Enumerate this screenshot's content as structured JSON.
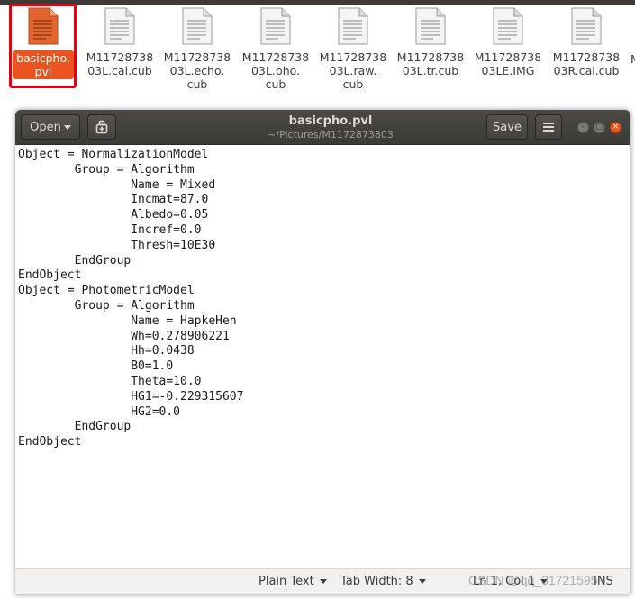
{
  "files": [
    {
      "name": "basicpho.\npvl",
      "type": "text",
      "selected": true
    },
    {
      "name": "M11728738\n03L.cal.cub",
      "type": "generic"
    },
    {
      "name": "M11728738\n03L.echo.\ncub",
      "type": "generic"
    },
    {
      "name": "M11728738\n03L.pho.\ncub",
      "type": "generic"
    },
    {
      "name": "M11728738\n03L.raw.\ncub",
      "type": "generic"
    },
    {
      "name": "M11728738\n03L.tr.cub",
      "type": "generic"
    },
    {
      "name": "M11728738\n03LE.IMG",
      "type": "generic"
    },
    {
      "name": "M11728738\n03R.cal.cub",
      "type": "generic"
    }
  ],
  "partial_file_name": "M",
  "window": {
    "title": "basicpho.pvl",
    "subtitle": "~/Pictures/M1172873803",
    "open_label": "Open",
    "save_label": "Save"
  },
  "editor_lines": [
    "Object = NormalizationModel",
    "        Group = Algorithm",
    "                Name = Mixed",
    "                Incmat=87.0",
    "                Albedo=0.05",
    "                Incref=0.0",
    "                Thresh=10E30",
    "        EndGroup",
    "EndObject",
    "Object = PhotometricModel",
    "        Group = Algorithm",
    "                Name = HapkeHen",
    "                Wh=0.278906221",
    "                Hh=0.0438",
    "                B0=1.0",
    "                Theta=10.0",
    "                HG1=-0.229315607",
    "                HG2=0.0",
    "        EndGroup",
    "EndObject"
  ],
  "statusbar": {
    "language": "Plain Text",
    "tab_width": "Tab Width: 8",
    "position": "Ln 1, Col 1",
    "mode": "INS"
  },
  "watermark": "CSDN @qq_31721595",
  "colors": {
    "accent": "#e95420",
    "selection_ring": "#e60012",
    "headerbar": "#3c3b37"
  }
}
